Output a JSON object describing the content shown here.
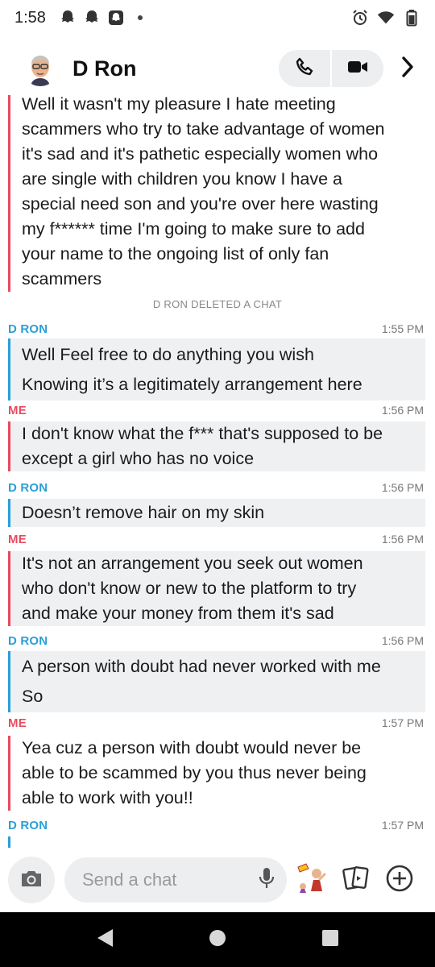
{
  "status_bar": {
    "time": "1:58",
    "left_icons": [
      "snapchat-ghost-icon",
      "snapchat-ghost-icon",
      "snapchat-app-icon",
      "notification-dot-icon"
    ],
    "right_icons": [
      "alarm-icon",
      "wifi-icon",
      "battery-icon"
    ]
  },
  "header": {
    "contact_name": "D Ron",
    "avatar": "bitmoji-avatar",
    "call_icons": [
      "phone-icon",
      "video-camera-icon"
    ],
    "more_icon": "chevron-right-icon"
  },
  "colors": {
    "me": "#e84a5f",
    "them": "#2a9fd8",
    "bubble_bg": "#eef0f2"
  },
  "chat": {
    "partial_top": {
      "sender": "me",
      "lines": [
        "Well it wasn't my pleasure I hate meeting",
        "scammers who try to take advantage of women",
        "it's sad and it's pathetic especially women who",
        "are single with children you know I have a",
        "special need son and you're over here wasting",
        "my f****** time I'm going to make sure to add",
        "your name to the ongoing list of only fan",
        "scammers"
      ]
    },
    "system_note": "D RON DELETED A CHAT",
    "messages": [
      {
        "sender_label": "D RON",
        "time": "1:55 PM",
        "lines": [
          "Well Feel free to do anything you wish",
          "Knowing it’s a legitimately arrangement here"
        ]
      },
      {
        "sender_label": "ME",
        "time": "1:56 PM",
        "lines": [
          "I don't know what the f*** that's supposed to be",
          "except a girl who has no voice"
        ]
      },
      {
        "sender_label": "D RON",
        "time": "1:56 PM",
        "lines": [
          "Doesn’t remove hair on my skin"
        ]
      },
      {
        "sender_label": "ME",
        "time": "1:56 PM",
        "lines": [
          "It's not an arrangement you seek out women",
          "who don't know or new to the platform to try",
          "and make your money from them it's sad"
        ]
      },
      {
        "sender_label": "D RON",
        "time": "1:56 PM",
        "lines": [
          "A person with doubt had never worked with me",
          "So"
        ]
      },
      {
        "sender_label": "ME",
        "time": "1:57 PM",
        "lines": [
          "Yea cuz a person with doubt would never be",
          "able to be scammed by you thus never being",
          "able to work with you!!"
        ]
      },
      {
        "sender_label": "D RON",
        "time": "1:57 PM",
        "lines": []
      }
    ]
  },
  "composer": {
    "placeholder": "Send a chat",
    "icons": [
      "camera-icon",
      "microphone-icon",
      "bitmoji-sticker-icon",
      "memories-cards-icon",
      "add-icon"
    ]
  },
  "navbar": {
    "icons": [
      "back-triangle-icon",
      "home-circle-icon",
      "recents-square-icon"
    ]
  }
}
